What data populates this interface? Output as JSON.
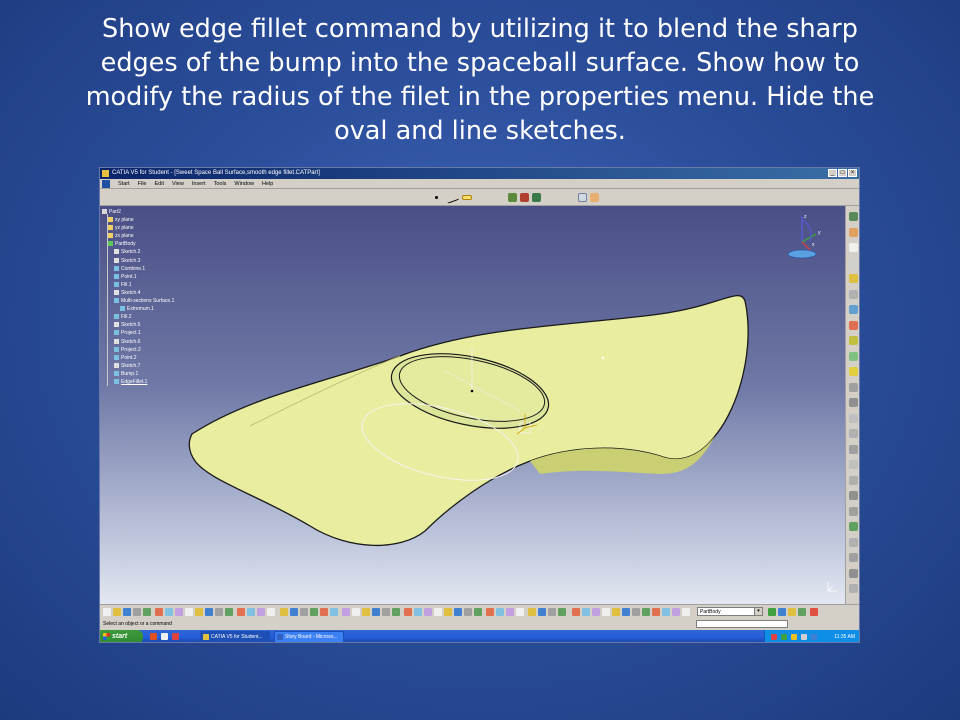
{
  "slide": {
    "title": "Show edge fillet command by utilizing it to blend the sharp edges of the bump into the spaceball surface. Show how to modify the radius of the filet in the properties menu. Hide the oval and line sketches."
  },
  "window": {
    "title": "CATIA V5 for Student - [Sweet Space Ball Surface,smooth edge fillet.CATPart]",
    "buttons": [
      "_",
      "□",
      "×"
    ]
  },
  "menu": {
    "items": [
      "Start",
      "File",
      "Edit",
      "View",
      "Insert",
      "Tools",
      "Window",
      "Help"
    ]
  },
  "tree": {
    "items": [
      {
        "label": "Part2",
        "kind": "root",
        "indent": 0
      },
      {
        "label": "xy plane",
        "kind": "plane",
        "indent": 1
      },
      {
        "label": "yz plane",
        "kind": "plane",
        "indent": 1
      },
      {
        "label": "zx plane",
        "kind": "plane",
        "indent": 1
      },
      {
        "label": "PartBody",
        "kind": "body",
        "indent": 1
      },
      {
        "label": "Sketch.2",
        "kind": "sketch",
        "indent": 2
      },
      {
        "label": "Sketch.3",
        "kind": "sketch",
        "indent": 2
      },
      {
        "label": "Combine.1",
        "kind": "feature",
        "indent": 2
      },
      {
        "label": "Point.1",
        "kind": "feature",
        "indent": 2
      },
      {
        "label": "Fill.1",
        "kind": "feature",
        "indent": 2
      },
      {
        "label": "Sketch.4",
        "kind": "sketch",
        "indent": 2
      },
      {
        "label": "Multi-sections Surface.1",
        "kind": "feature",
        "indent": 2
      },
      {
        "label": "Extremum.1",
        "kind": "feature",
        "indent": 3
      },
      {
        "label": "Fill.2",
        "kind": "feature",
        "indent": 2
      },
      {
        "label": "Sketch.5",
        "kind": "sketch",
        "indent": 2
      },
      {
        "label": "Project.1",
        "kind": "feature",
        "indent": 2
      },
      {
        "label": "Sketch.6",
        "kind": "sketch",
        "indent": 2
      },
      {
        "label": "Project.2",
        "kind": "feature",
        "indent": 2
      },
      {
        "label": "Point.2",
        "kind": "feature",
        "indent": 2
      },
      {
        "label": "Sketch.7",
        "kind": "sketch",
        "indent": 2
      },
      {
        "label": "Bump.1",
        "kind": "feature",
        "indent": 2
      },
      {
        "label": "EdgeFillet.1",
        "kind": "feature-selected",
        "indent": 2
      }
    ]
  },
  "compass": {
    "axis_x": "x",
    "axis_y": "y",
    "axis_z": "z"
  },
  "toolbar": {
    "body_selector": "PartBody"
  },
  "status": {
    "prompt": "Select an object or a command"
  },
  "taskbar": {
    "start_label": "start",
    "tasks": [
      "CATIA V5 for Student...",
      "Story Board - Microso..."
    ],
    "clock": "11:35 AM"
  },
  "colors": {
    "surface_fill": "#e8eda0",
    "surface_shade": "#c9cf72",
    "background_top": "#4a4f86",
    "background_bottom": "#e3e7f1"
  }
}
